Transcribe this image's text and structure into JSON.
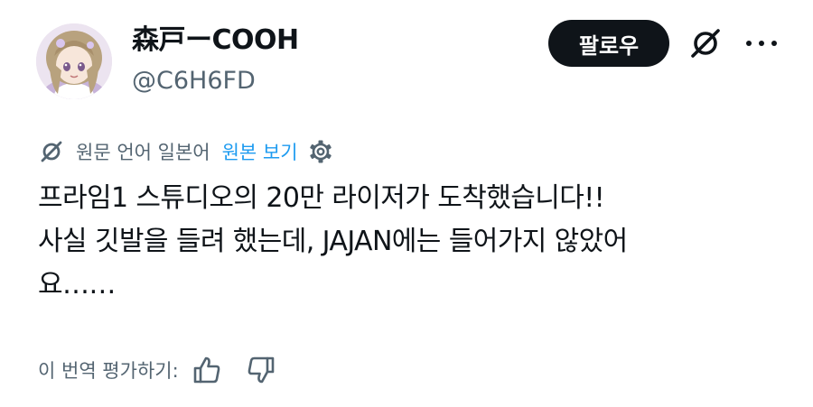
{
  "author": {
    "display_name": "森戸ーCOOH",
    "handle": "@C6H6FD"
  },
  "follow_button": {
    "label": "팔로우"
  },
  "icons": {
    "translate": "translate-icon",
    "more": "more-icon",
    "settings": "gear-icon",
    "thumbs_up": "thumbs-up-icon",
    "thumbs_down": "thumbs-down-icon"
  },
  "translation": {
    "language_note": "원문 언어 일본어",
    "show_original": "원본 보기"
  },
  "tweet": {
    "lines": [
      "프라임1 스튜디오의 20만 라이저가 도착했습니다!!",
      "사실 깃발을 들려 했는데, JAJAN에는 들어가지 않았어",
      "요……"
    ]
  },
  "rating": {
    "label": "이 번역 평가하기:"
  },
  "colors": {
    "text": "#0f1419",
    "secondary_text": "#536471",
    "link": "#1d9bf0",
    "button_bg": "#0f1419",
    "button_text": "#ffffff"
  }
}
